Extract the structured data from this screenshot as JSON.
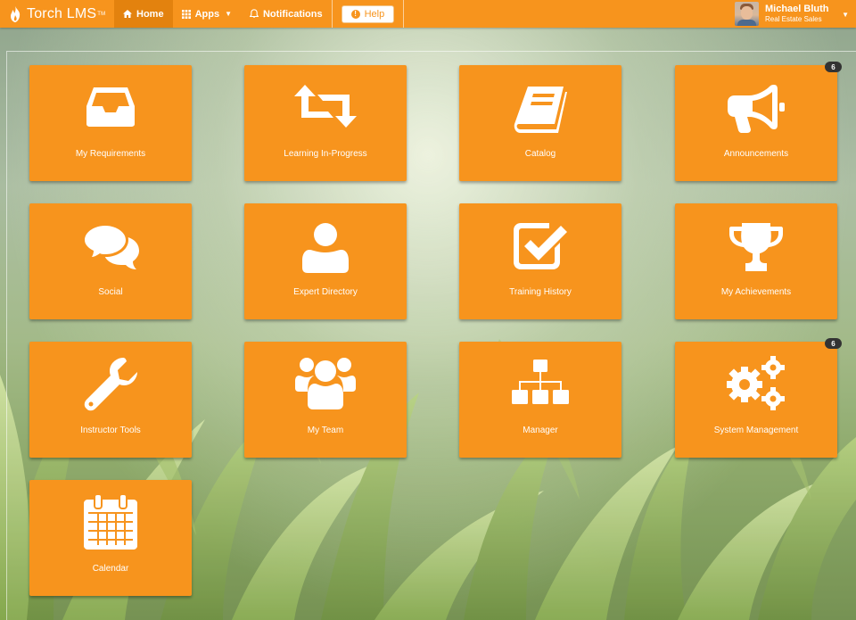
{
  "app": {
    "logo_text": "Torch LMS",
    "logo_tm": "TM"
  },
  "nav": {
    "home": "Home",
    "apps": "Apps",
    "notifications": "Notifications",
    "help": "Help"
  },
  "user": {
    "name": "Michael Bluth",
    "role": "Real Estate Sales"
  },
  "colors": {
    "accent": "#f7941d",
    "accent_dark": "#e3820e",
    "badge": "#333333"
  },
  "tiles": [
    {
      "label": "My Requirements",
      "icon": "inbox-icon"
    },
    {
      "label": "Learning In-Progress",
      "icon": "retweet-icon"
    },
    {
      "label": "Catalog",
      "icon": "book-icon"
    },
    {
      "label": "Announcements",
      "icon": "megaphone-icon",
      "badge": "6"
    },
    {
      "label": "Social",
      "icon": "chat-bubbles-icon"
    },
    {
      "label": "Expert Directory",
      "icon": "user-icon"
    },
    {
      "label": "Training History",
      "icon": "checkbox-icon"
    },
    {
      "label": "My Achievements",
      "icon": "trophy-icon"
    },
    {
      "label": "Instructor Tools",
      "icon": "wrench-icon"
    },
    {
      "label": "My Team",
      "icon": "users-icon"
    },
    {
      "label": "Manager",
      "icon": "sitemap-icon"
    },
    {
      "label": "System Management",
      "icon": "gears-icon",
      "badge": "6"
    },
    {
      "label": "Calendar",
      "icon": "calendar-icon"
    }
  ]
}
